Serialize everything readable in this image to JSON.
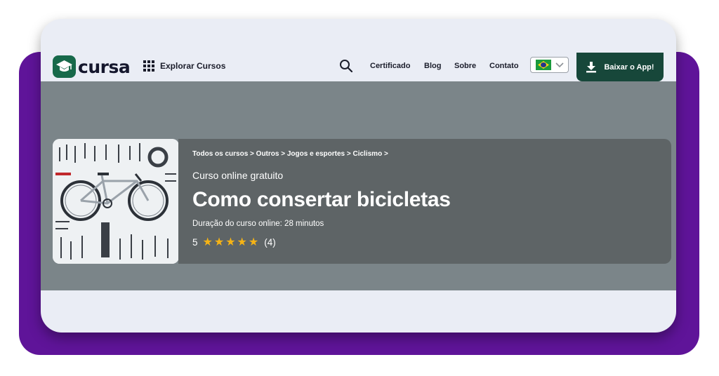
{
  "header": {
    "logo_text": "cursa",
    "explore_label": "Explorar Cursos",
    "links": [
      "Certificado",
      "Blog",
      "Sobre",
      "Contato"
    ],
    "app_button_label": "Baixar o App!"
  },
  "hero": {
    "breadcrumb": "Todos os cursos > Outros > Jogos e esportes > Ciclismo >",
    "subtitle": "Curso online gratuito",
    "title": "Como consertar bicicletas",
    "duration": "Duração do curso online: 28 minutos",
    "rating_value": "5",
    "rating_stars": 5,
    "rating_count": "(4)"
  },
  "colors": {
    "brand_green": "#17694a",
    "app_button": "#17473a",
    "frame_purple": "#5f1499",
    "star": "#f5b316"
  },
  "icons": [
    "grid-icon",
    "search-icon",
    "brazil-flag-icon",
    "chevron-down-icon",
    "download-icon",
    "star-icon"
  ]
}
